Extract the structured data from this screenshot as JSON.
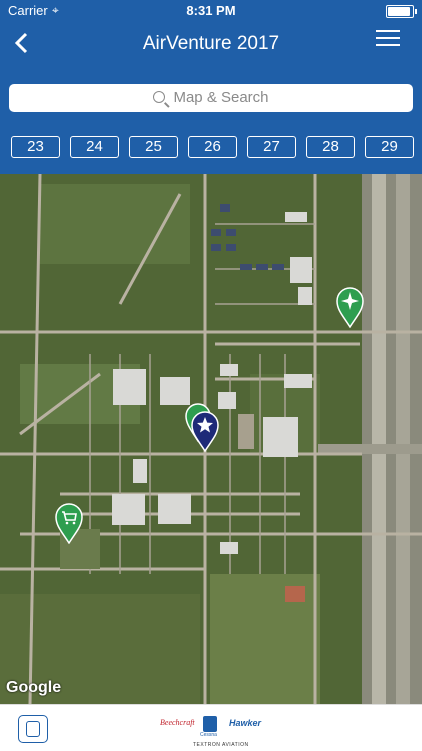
{
  "status_bar": {
    "carrier": "Carrier",
    "time": "8:31 PM"
  },
  "navbar": {
    "title": "AirVenture 2017",
    "back_icon": "chevron-left-icon",
    "menu_icon": "hamburger-menu-icon"
  },
  "search": {
    "placeholder": "Map & Search"
  },
  "days": [
    "23",
    "24",
    "25",
    "26",
    "27",
    "28",
    "29"
  ],
  "map": {
    "attribution": "Google",
    "pins": [
      "propeller-pin",
      "location-pin",
      "star-pin",
      "shopping-cart-pin"
    ]
  },
  "footer": {
    "sponsor_logo_text": {
      "beechcraft": "Beechcraft",
      "cessna": "Cessna",
      "hawker": "Hawker",
      "textron": "TEXTRON AVIATION"
    },
    "settings_icon": "settings-icon"
  },
  "colors": {
    "primary": "#1f5fa8",
    "pin_green": "#2e9e4f",
    "pin_navy": "#1e2a78"
  }
}
